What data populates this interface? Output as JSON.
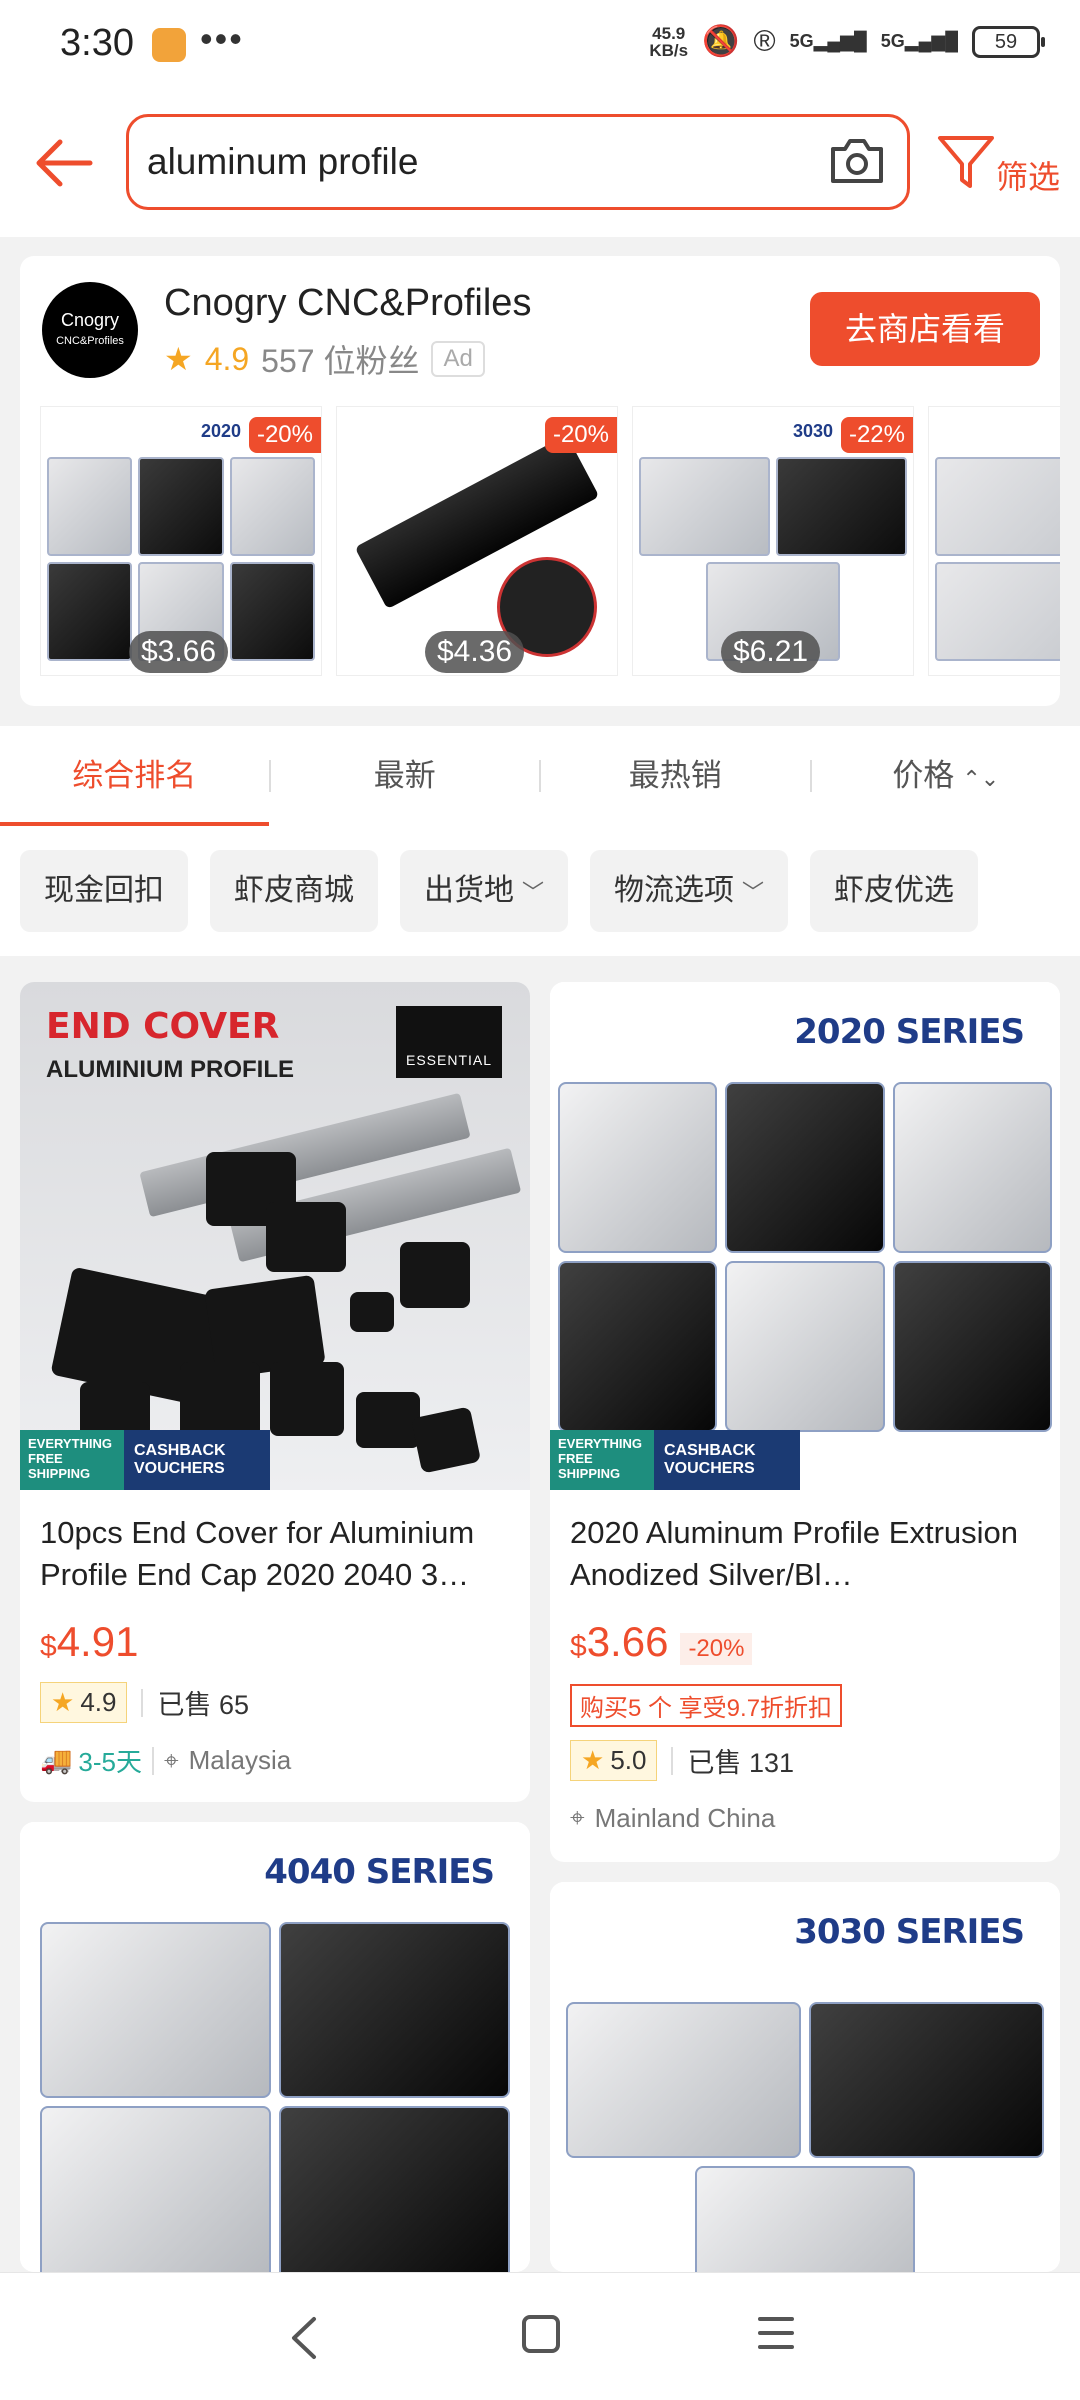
{
  "status_bar": {
    "time": "3:30",
    "dots": "•••",
    "net_speed_top": "45.9",
    "net_speed_bottom": "KB/s",
    "sim1": "5G",
    "sim2": "5G",
    "battery": "59"
  },
  "header": {
    "search_value": "aluminum profile",
    "filter_label": "筛选"
  },
  "shop": {
    "logo_top": "Cnogry",
    "logo_bottom": "CNC&Profiles",
    "name": "Cnogry CNC&Profiles",
    "rating": "4.9",
    "followers": "557 位粉丝",
    "ad_label": "Ad",
    "visit_button": "去商店看看",
    "items": [
      {
        "series": "2020",
        "discount": "-20%",
        "price": "$3.66"
      },
      {
        "series": "",
        "discount": "-20%",
        "price": "$4.36"
      },
      {
        "series": "3030",
        "discount": "-22%",
        "price": "$6.21"
      },
      {
        "series": "",
        "discount": "",
        "price": "$"
      }
    ]
  },
  "sort_tabs": {
    "relevance": "综合排名",
    "latest": "最新",
    "top_sales": "最热销",
    "price": "价格"
  },
  "filter_chips": {
    "cashback": "现金回扣",
    "mall": "虾皮商城",
    "ship_from": "出货地",
    "logistics": "物流选项",
    "preferred": "虾皮优选"
  },
  "products": [
    {
      "img_title": "END COVER",
      "img_subtitle": "ALUMINIUM PROFILE",
      "brand_badge": "ESSENTIAL",
      "promo_left": "EVERYTHING FREE SHIPPING",
      "promo_right": "CASHBACK VOUCHERS",
      "title": "10pcs End Cover for Aluminium Profile End Cap 2020 2040 3…",
      "currency": "$",
      "price": "4.91",
      "rating": "4.9",
      "sold": "已售 65",
      "ship_days": "3-5天",
      "location": "Malaysia"
    },
    {
      "img_title": "2020 SERIES",
      "promo_left": "EVERYTHING FREE SHIPPING",
      "promo_right": "CASHBACK VOUCHERS",
      "title": "2020 Aluminum Profile Extrusion Anodized Silver/Bl…",
      "currency": "$",
      "price": "3.66",
      "discount": "-20%",
      "bulk_offer": "购买5 个 享受9.7折折扣",
      "rating": "5.0",
      "sold": "已售 131",
      "location": "Mainland China"
    },
    {
      "img_title": "4040 SERIES"
    },
    {
      "img_title": "3030 SERIES"
    }
  ],
  "colors": {
    "accent": "#ee4d2d",
    "series_blue": "#1f3c88",
    "ship_green": "#26aa99",
    "star": "#f5a623"
  }
}
